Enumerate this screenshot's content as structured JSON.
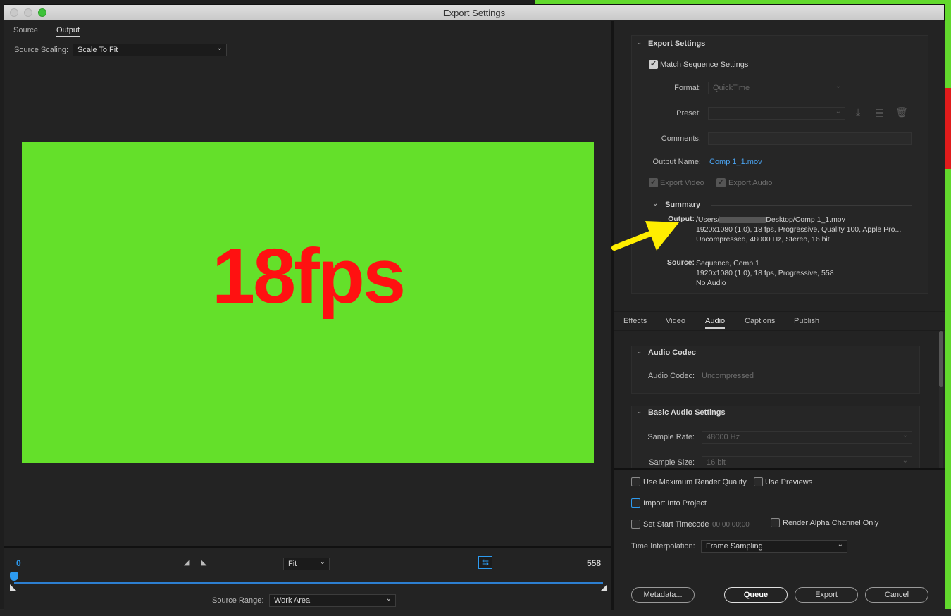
{
  "window": {
    "title": "Export Settings"
  },
  "left": {
    "tabs": [
      {
        "label": "Source"
      },
      {
        "label": "Output"
      }
    ],
    "source_scaling_label": "Source Scaling:",
    "source_scaling_value": "Scale To Fit",
    "preview_text": "18fps"
  },
  "timeline": {
    "start": "0",
    "end": "558",
    "fit_value": "Fit",
    "source_range_label": "Source Range:",
    "source_range_value": "Work Area"
  },
  "export_settings": {
    "title": "Export Settings",
    "match_sequence": "Match Sequence Settings",
    "format_label": "Format:",
    "format_value": "QuickTime",
    "preset_label": "Preset:",
    "comments_label": "Comments:",
    "output_name_label": "Output Name:",
    "output_name_value": "Comp 1_1.mov",
    "export_video": "Export Video",
    "export_audio": "Export Audio",
    "summary_title": "Summary",
    "output_key": "Output:",
    "output_line1_a": "/Users/",
    "output_line1_b": "Desktop/Comp 1_1.mov",
    "output_line2": "1920x1080 (1.0), 18 fps, Progressive, Quality 100, Apple Pro...",
    "output_line3": "Uncompressed, 48000 Hz, Stereo, 16 bit",
    "source_key": "Source:",
    "source_line1": "Sequence, Comp 1",
    "source_line2": "1920x1080 (1.0), 18 fps, Progressive, 558",
    "source_line3": "No Audio"
  },
  "right_tabs": [
    {
      "label": "Effects"
    },
    {
      "label": "Video"
    },
    {
      "label": "Audio"
    },
    {
      "label": "Captions"
    },
    {
      "label": "Publish"
    }
  ],
  "audio": {
    "codec_section": "Audio Codec",
    "codec_label": "Audio Codec:",
    "codec_value": "Uncompressed",
    "basic_section": "Basic Audio Settings",
    "sample_rate_label": "Sample Rate:",
    "sample_rate_value": "48000 Hz",
    "sample_size_label": "Sample Size:",
    "sample_size_value": "16 bit"
  },
  "options": {
    "max_render": "Use Maximum Render Quality",
    "use_previews": "Use Previews",
    "import_into_project": "Import Into Project",
    "set_start_tc": "Set Start Timecode",
    "start_tc_value": "00;00;00;00",
    "render_alpha": "Render Alpha Channel Only",
    "time_interp_label": "Time Interpolation:",
    "time_interp_value": "Frame Sampling"
  },
  "buttons": {
    "metadata": "Metadata...",
    "queue": "Queue",
    "export": "Export",
    "cancel": "Cancel"
  },
  "colors": {
    "accent": "#2d9bf0",
    "preview_bg": "#64e02a",
    "preview_text": "#ff1111"
  }
}
